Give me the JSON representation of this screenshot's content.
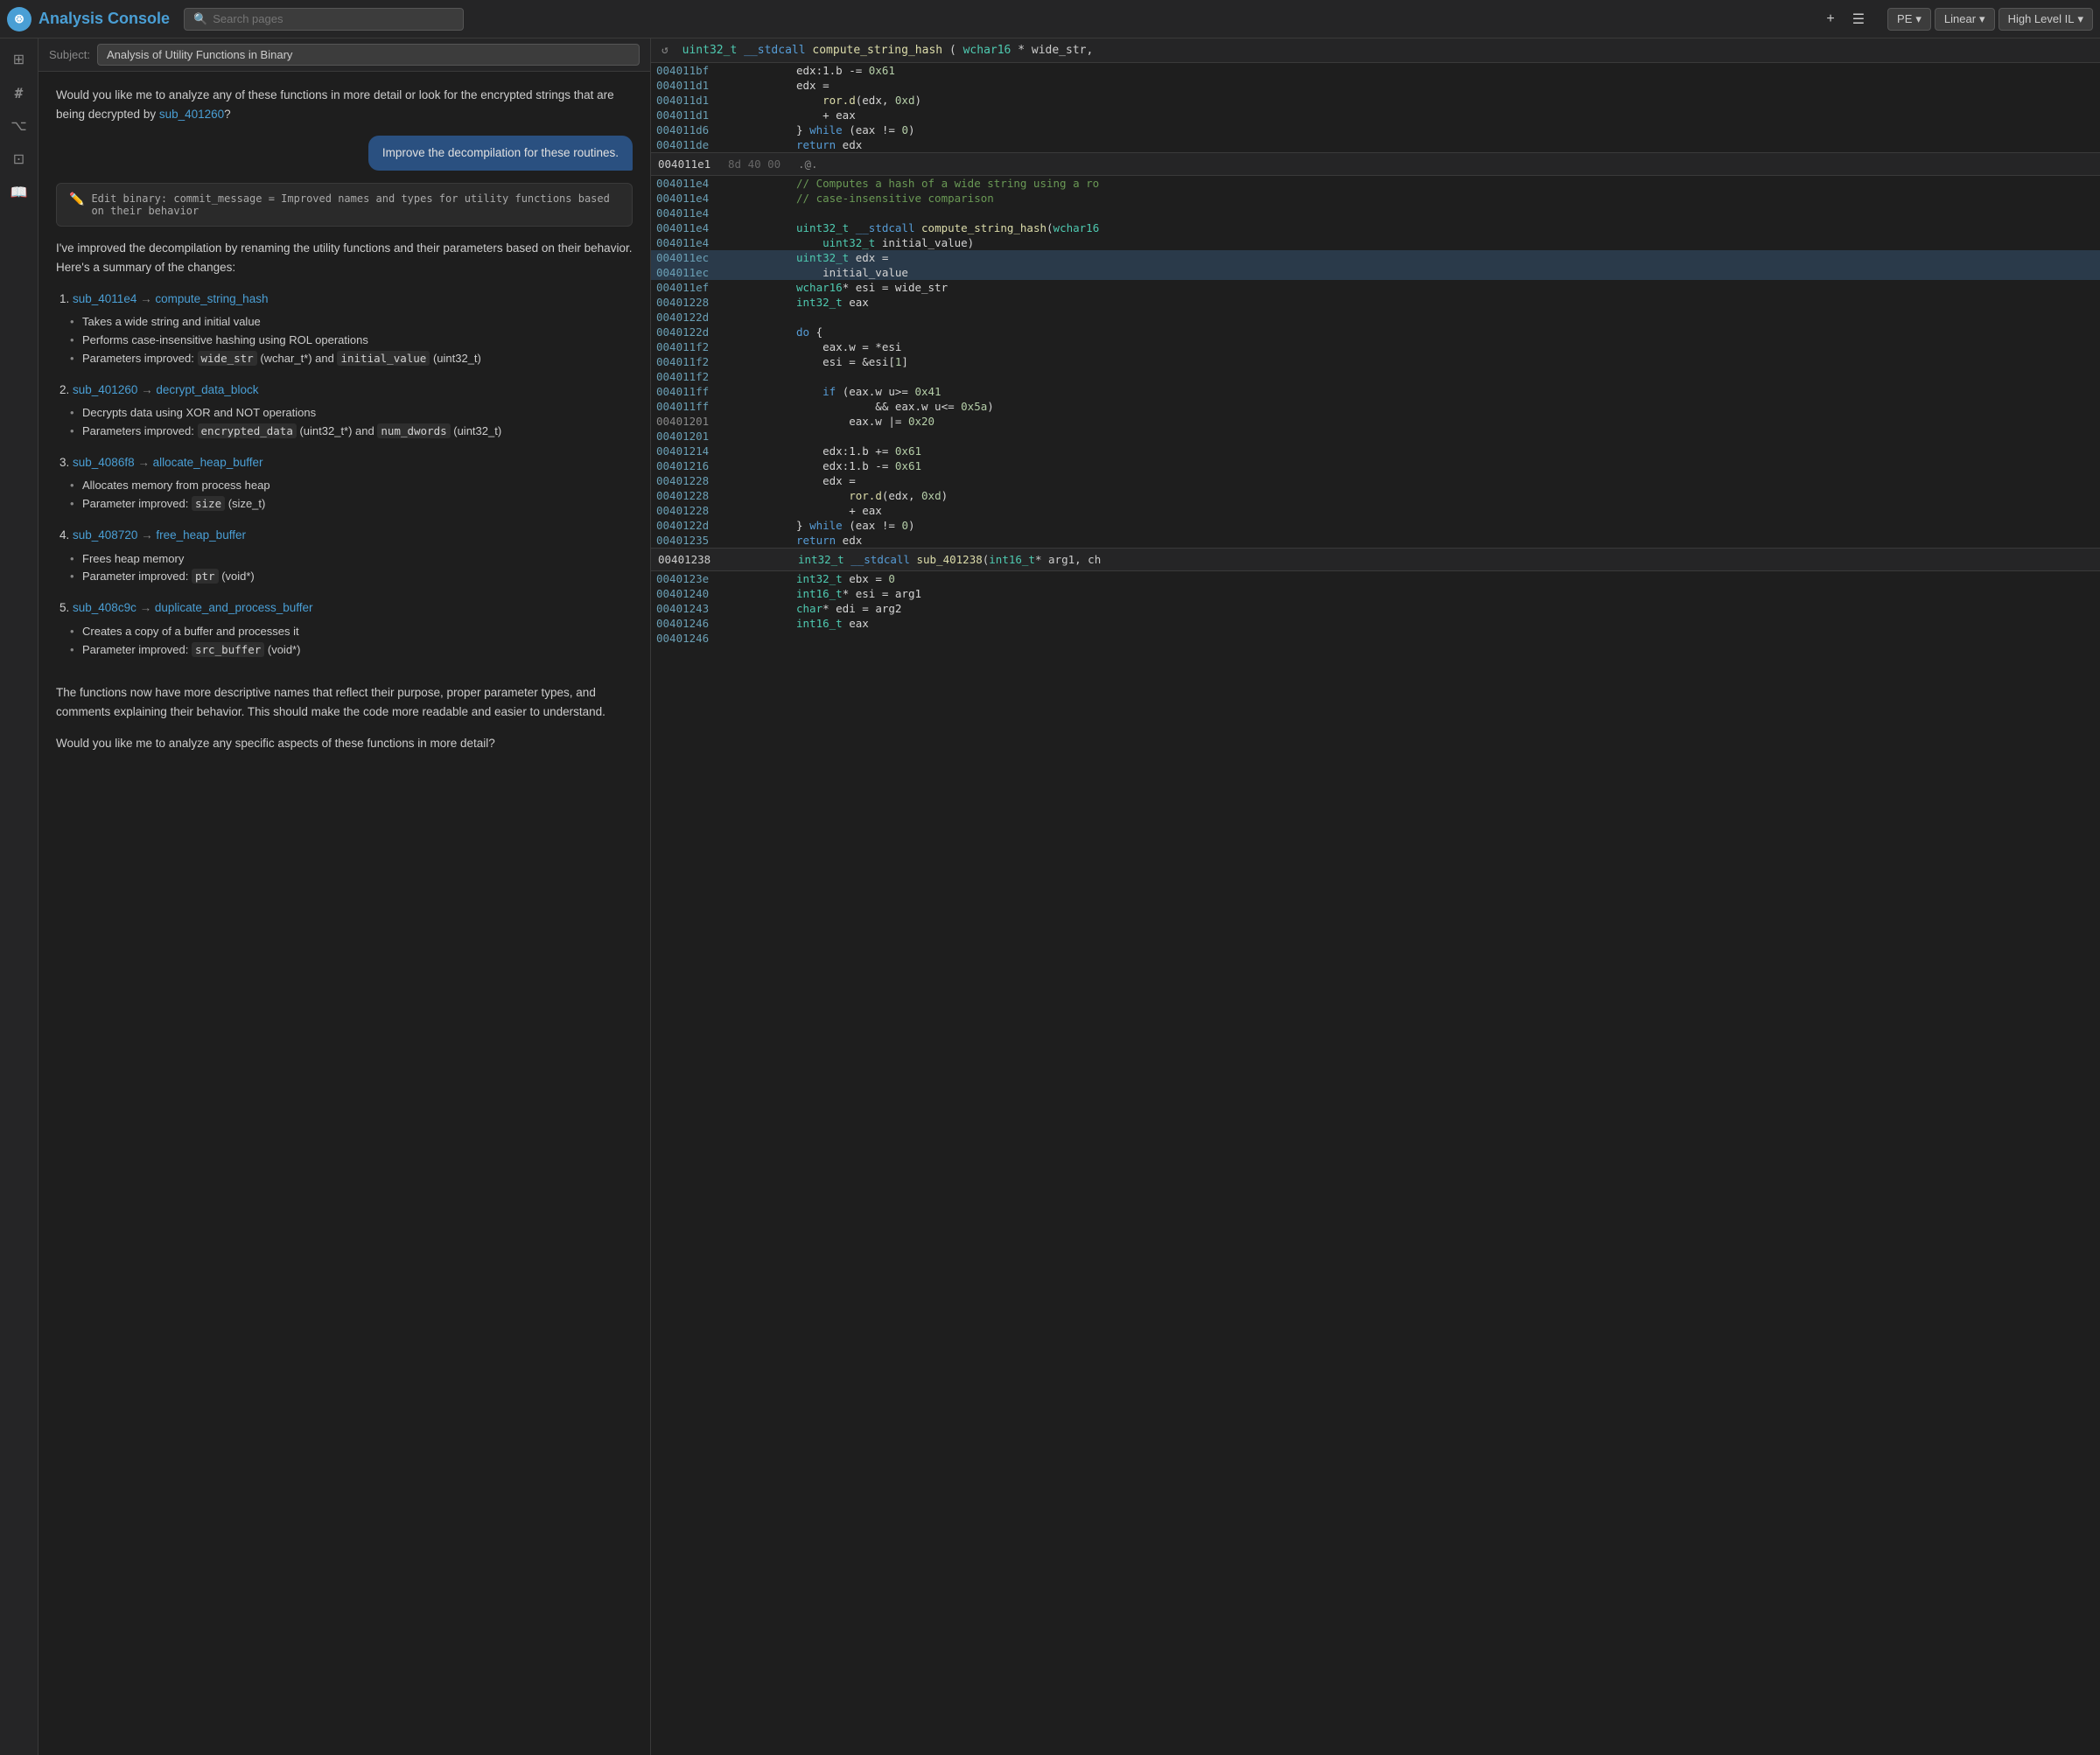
{
  "topbar": {
    "title": "Analysis Console",
    "search_placeholder": "Search pages",
    "add_btn": "+",
    "menu_btn": "☰"
  },
  "right_nav": {
    "pe_label": "PE",
    "linear_label": "Linear",
    "hil_label": "High Level IL",
    "chevron": "▾"
  },
  "subject": {
    "label": "Subject:",
    "value": "Analysis of Utility Functions in Binary"
  },
  "chat": {
    "intro_text": "Would you like me to analyze any of these functions in more detail or look for the encrypted strings that are being decrypted by ",
    "sub_link": "sub_401260",
    "intro_end": "?",
    "user_bubble": "Improve the decompilation for these routines.",
    "commit_icon": "✏️",
    "commit_text": "Edit binary: commit_message = Improved names and types for utility functions based on their behavior",
    "response_intro": "I've improved the decompilation by renaming the utility functions and their parameters based on their behavior. Here's a summary of the changes:",
    "items": [
      {
        "num": "1.",
        "old_link": "sub_4011e4",
        "arrow": "→",
        "new_link": "compute_string_hash",
        "bullets": [
          "Takes a wide string and initial value",
          "Performs case-insensitive hashing using ROL operations",
          "Parameters improved: wide_str (wchar_t*) and initial_value (uint32_t)"
        ]
      },
      {
        "num": "2.",
        "old_link": "sub_401260",
        "arrow": "→",
        "new_link": "decrypt_data_block",
        "bullets": [
          "Decrypts data using XOR and NOT operations",
          "Parameters improved: encrypted_data (uint32_t*) and num_dwords (uint32_t)"
        ]
      },
      {
        "num": "3.",
        "old_link": "sub_4086f8",
        "arrow": "→",
        "new_link": "allocate_heap_buffer",
        "bullets": [
          "Allocates memory from process heap",
          "Parameter improved: size (size_t)"
        ]
      },
      {
        "num": "4.",
        "old_link": "sub_408720",
        "arrow": "→",
        "new_link": "free_heap_buffer",
        "bullets": [
          "Frees heap memory",
          "Parameter improved: ptr (void*)"
        ]
      },
      {
        "num": "5.",
        "old_link": "sub_408c9c",
        "arrow": "→",
        "new_link": "duplicate_and_process_buffer",
        "bullets": [
          "Creates a copy of a buffer and processes it",
          "Parameter improved: src_buffer (void*)"
        ]
      }
    ],
    "footer_text": "The functions now have more descriptive names that reflect their purpose, proper parameter types, and comments explaining their behavior. This should make the code more readable and easier to understand.",
    "final_question": "Would you like me to analyze any specific aspects of these functions in more detail?"
  },
  "code_header": {
    "text": "uint32_t __stdcall compute_string_hash(wchar16* wide_str,"
  },
  "code_lines": [
    {
      "addr": "004011bf",
      "hex": "",
      "code": "edx:1.b -= 0x61",
      "style": "normal"
    },
    {
      "addr": "004011d1",
      "hex": "",
      "code": "edx =",
      "style": "normal"
    },
    {
      "addr": "004011d1",
      "hex": "",
      "code": "    ror.d(edx, 0xd)",
      "style": "normal"
    },
    {
      "addr": "004011d1",
      "hex": "",
      "code": "    + eax",
      "style": "normal"
    },
    {
      "addr": "004011d6",
      "hex": "",
      "code": "} while (eax != 0)",
      "style": "normal"
    },
    {
      "addr": "004011de",
      "hex": "",
      "code": "return edx",
      "style": "normal"
    }
  ],
  "section1": {
    "addr": "004011e1",
    "hex": "8d 40 00",
    "code": ".@."
  },
  "section2_header": {
    "addr": "004011e4",
    "lines": [
      {
        "addr": "004011e4",
        "code": "// Computes a hash of a wide string using a ro",
        "style": "comment"
      },
      {
        "addr": "004011e4",
        "code": "// case-insensitive comparison",
        "style": "comment"
      },
      {
        "addr": "004011e4",
        "code": "",
        "style": "blank"
      },
      {
        "addr": "004011e4",
        "code": "uint32_t __stdcall compute_string_hash(wchar16",
        "style": "fn"
      },
      {
        "addr": "004011e4",
        "code": "    uint32_t initial_value)",
        "style": "normal"
      }
    ]
  },
  "section3": {
    "highlighted_addr": "004011ec",
    "lines": [
      {
        "addr": "004011ec",
        "code": "uint32_t edx =",
        "style": "normal"
      },
      {
        "addr": "004011ec",
        "code": "    initial_value",
        "style": "normal"
      },
      {
        "addr": "004011ef",
        "code": "wchar16* esi = wide_str",
        "style": "normal"
      },
      {
        "addr": "00401228",
        "code": "int32_t eax",
        "style": "normal"
      },
      {
        "addr": "0040122d",
        "code": "",
        "style": "blank"
      },
      {
        "addr": "0040122d",
        "code": "do {",
        "style": "normal"
      },
      {
        "addr": "004011f2",
        "code": "    eax.w = *esi",
        "style": "normal"
      },
      {
        "addr": "004011f2",
        "code": "    esi = &esi[1]",
        "style": "normal"
      },
      {
        "addr": "004011f2",
        "code": "",
        "style": "blank"
      },
      {
        "addr": "004011ff",
        "code": "    if (eax.w u>= 0x41",
        "style": "normal"
      },
      {
        "addr": "004011ff",
        "code": "            && eax.w u<= 0x5a)",
        "style": "normal"
      },
      {
        "addr": "00401201",
        "code": "        eax.w |= 0x20",
        "style": "normal"
      },
      {
        "addr": "00401201",
        "code": "",
        "style": "blank"
      },
      {
        "addr": "00401214",
        "code": "    edx:1.b += 0x61",
        "style": "normal"
      },
      {
        "addr": "00401216",
        "code": "    edx:1.b -= 0x61",
        "style": "normal"
      },
      {
        "addr": "00401228",
        "code": "    edx =",
        "style": "normal"
      },
      {
        "addr": "00401228",
        "code": "        ror.d(edx, 0xd)",
        "style": "normal"
      },
      {
        "addr": "00401228",
        "code": "        + eax",
        "style": "normal"
      },
      {
        "addr": "0040122d",
        "code": "} while (eax != 0)",
        "style": "normal"
      },
      {
        "addr": "00401235",
        "code": "return edx",
        "style": "normal"
      }
    ]
  },
  "section4_header": {
    "addr": "00401238",
    "code": "int32_t __stdcall sub_401238(int16_t* arg1, ch"
  },
  "section4_lines": [
    {
      "addr": "0040123e",
      "code": "int32_t ebx = 0",
      "style": "normal"
    },
    {
      "addr": "00401240",
      "code": "int16_t* esi = arg1",
      "style": "normal"
    },
    {
      "addr": "00401243",
      "code": "char* edi = arg2",
      "style": "normal"
    },
    {
      "addr": "00401246",
      "code": "int16_t eax",
      "style": "normal"
    },
    {
      "addr": "00401246",
      "code": "",
      "style": "blank"
    }
  ],
  "sidebar_icons": [
    {
      "name": "home-icon",
      "glyph": "⊞",
      "active": false
    },
    {
      "name": "hash-icon",
      "glyph": "#",
      "active": false
    },
    {
      "name": "code-icon",
      "glyph": "⌥",
      "active": false
    },
    {
      "name": "graph-icon",
      "glyph": "⊡",
      "active": false
    },
    {
      "name": "book-icon",
      "glyph": "📖",
      "active": false
    }
  ]
}
